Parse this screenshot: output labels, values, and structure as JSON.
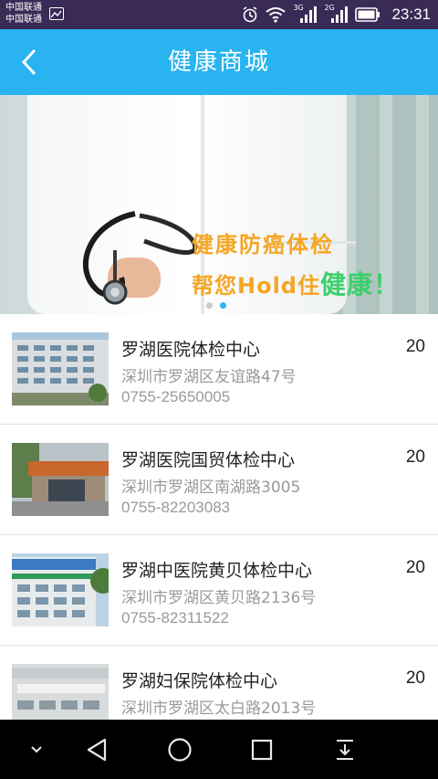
{
  "status_bar": {
    "carrier_1": "中国联通",
    "carrier_2": "中国联通",
    "network_1": "3G",
    "network_2": "2G",
    "time": "23:31",
    "icons": [
      "gallery-icon",
      "alarm-icon",
      "wifi-icon",
      "signal-3g-icon",
      "signal-2g-icon",
      "battery-icon"
    ]
  },
  "header": {
    "title": "健康商城",
    "back_icon": "chevron-left-icon"
  },
  "banner": {
    "slogan_line1": "健康防癌体检",
    "slogan_line2_prefix": "帮您Hold住",
    "slogan_line2_highlight": "健康！",
    "slide_count": 2,
    "active_slide": 2,
    "colors": {
      "orange": "#f5a623",
      "green": "#3ccf6b"
    }
  },
  "items": [
    {
      "name": "罗湖医院体检中心",
      "address": "深圳市罗湖区友谊路47号",
      "phone": "0755-25650005",
      "price": "20"
    },
    {
      "name": "罗湖医院国贸体检中心",
      "address": "深圳市罗湖区南湖路3005",
      "phone": "0755-82203083",
      "price": "20"
    },
    {
      "name": "罗湖中医院黄贝体检中心",
      "address": "深圳市罗湖区黄贝路2136号",
      "phone": "0755-82311522",
      "price": "20"
    },
    {
      "name": "罗湖妇保院体检中心",
      "address": "深圳市罗湖区太白路2013号",
      "phone": "",
      "price": "20"
    }
  ],
  "nav_bar": {
    "buttons": [
      "collapse-icon",
      "back-triangle-icon",
      "home-circle-icon",
      "recents-square-icon",
      "notification-pull-icon"
    ]
  },
  "colors": {
    "header_bg": "#29b3f0",
    "status_bg": "#3a2b56",
    "accent": "#29b3f0"
  }
}
